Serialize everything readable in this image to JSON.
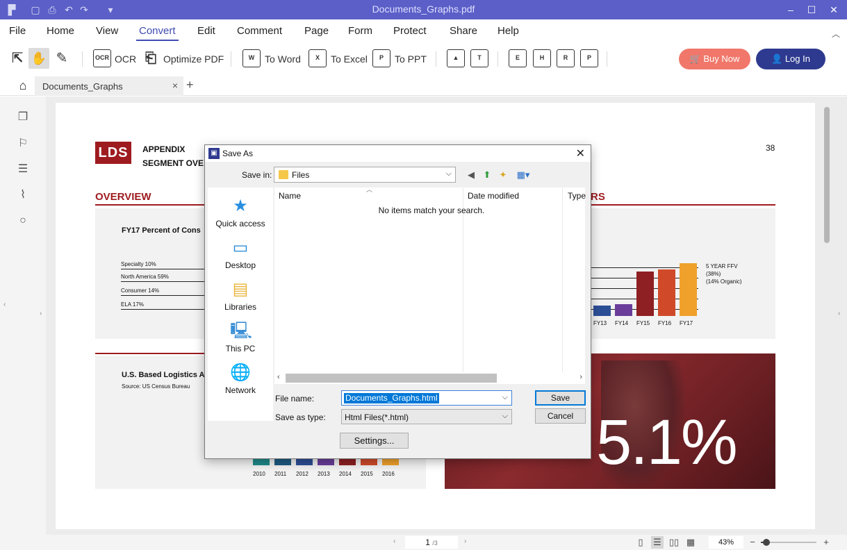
{
  "titlebar": {
    "title": "Documents_Graphs.pdf",
    "minimize": "–",
    "maximize": "☐",
    "close": "✕"
  },
  "menu": {
    "items": [
      "File",
      "Home",
      "View",
      "Convert",
      "Edit",
      "Comment",
      "Page",
      "Form",
      "Protect",
      "Share",
      "Help"
    ],
    "active": "Convert"
  },
  "toolbar": {
    "ocr_icon": "OCR",
    "ocr": "OCR",
    "optimize": "Optimize PDF",
    "to_word": "To Word",
    "to_excel": "To Excel",
    "to_ppt": "To PPT",
    "buy_now": "Buy Now",
    "log_in": "Log In"
  },
  "tabs": {
    "doc_name": "Documents_Graphs",
    "close": "×",
    "add": "+"
  },
  "pdf": {
    "logo": "LDS",
    "appendix": "APPENDIX",
    "segment": "SEGMENT OVE",
    "page_number": "38",
    "overview": "OVERVIEW",
    "right_heading_tail": "RS",
    "fy17_title": "FY17 Percent of Cons",
    "segments": [
      "Specialty 10%",
      "North America 59%",
      "Consumer 14%",
      "ELA 17%"
    ],
    "usb_title": "U.S. Based Logistics A",
    "usb_source": "Source: US Census Bureau",
    "big_stat": "5.1%",
    "ffv_lines": [
      "5 YEAR FFV",
      "(38%)",
      "(14% Organic)"
    ]
  },
  "chart_data": [
    {
      "type": "bar",
      "categories": [
        "FY13",
        "FY14",
        "FY15",
        "FY16",
        "FY17"
      ],
      "values": [
        15,
        17,
        64,
        67,
        76
      ],
      "ylim": [
        0,
        80
      ],
      "colors": [
        "#2d4f96",
        "#6a3d9a",
        "#8e1f22",
        "#d04a2a",
        "#f0a12b"
      ]
    },
    {
      "type": "bar",
      "categories": [
        "2010",
        "2011",
        "2012",
        "2013",
        "2014",
        "2015",
        "2016"
      ],
      "colors": [
        "#1f8a8a",
        "#1d5a82",
        "#2d4f96",
        "#6a3d9a",
        "#8e1f22",
        "#d04a2a",
        "#f0a12b"
      ]
    }
  ],
  "dialog": {
    "title": "Save As",
    "close": "✕",
    "save_in_label": "Save in:",
    "save_in_value": "Files",
    "places": [
      "Quick access",
      "Desktop",
      "Libraries",
      "This PC",
      "Network"
    ],
    "columns": [
      "Name",
      "Date modified",
      "Type"
    ],
    "empty_message": "No items match your search.",
    "file_name_label": "File name:",
    "file_name_value": "Documents_Graphs.html",
    "save_type_label": "Save as type:",
    "save_type_value": "Html Files(*.html)",
    "save_button": "Save",
    "cancel_button": "Cancel",
    "settings_button": "Settings..."
  },
  "status": {
    "current_page": "1",
    "total_pages": "/3",
    "zoom": "43%",
    "zoom_minus": "−",
    "zoom_plus": "+",
    "zoom_level": 0.43
  }
}
